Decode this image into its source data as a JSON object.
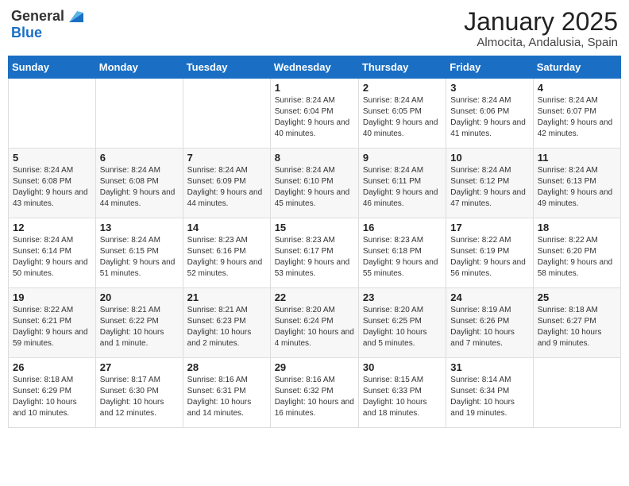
{
  "header": {
    "logo_general": "General",
    "logo_blue": "Blue",
    "title": "January 2025",
    "subtitle": "Almocita, Andalusia, Spain"
  },
  "weekdays": [
    "Sunday",
    "Monday",
    "Tuesday",
    "Wednesday",
    "Thursday",
    "Friday",
    "Saturday"
  ],
  "weeks": [
    [
      {
        "day": "",
        "info": ""
      },
      {
        "day": "",
        "info": ""
      },
      {
        "day": "",
        "info": ""
      },
      {
        "day": "1",
        "info": "Sunrise: 8:24 AM\nSunset: 6:04 PM\nDaylight: 9 hours and 40 minutes."
      },
      {
        "day": "2",
        "info": "Sunrise: 8:24 AM\nSunset: 6:05 PM\nDaylight: 9 hours and 40 minutes."
      },
      {
        "day": "3",
        "info": "Sunrise: 8:24 AM\nSunset: 6:06 PM\nDaylight: 9 hours and 41 minutes."
      },
      {
        "day": "4",
        "info": "Sunrise: 8:24 AM\nSunset: 6:07 PM\nDaylight: 9 hours and 42 minutes."
      }
    ],
    [
      {
        "day": "5",
        "info": "Sunrise: 8:24 AM\nSunset: 6:08 PM\nDaylight: 9 hours and 43 minutes."
      },
      {
        "day": "6",
        "info": "Sunrise: 8:24 AM\nSunset: 6:08 PM\nDaylight: 9 hours and 44 minutes."
      },
      {
        "day": "7",
        "info": "Sunrise: 8:24 AM\nSunset: 6:09 PM\nDaylight: 9 hours and 44 minutes."
      },
      {
        "day": "8",
        "info": "Sunrise: 8:24 AM\nSunset: 6:10 PM\nDaylight: 9 hours and 45 minutes."
      },
      {
        "day": "9",
        "info": "Sunrise: 8:24 AM\nSunset: 6:11 PM\nDaylight: 9 hours and 46 minutes."
      },
      {
        "day": "10",
        "info": "Sunrise: 8:24 AM\nSunset: 6:12 PM\nDaylight: 9 hours and 47 minutes."
      },
      {
        "day": "11",
        "info": "Sunrise: 8:24 AM\nSunset: 6:13 PM\nDaylight: 9 hours and 49 minutes."
      }
    ],
    [
      {
        "day": "12",
        "info": "Sunrise: 8:24 AM\nSunset: 6:14 PM\nDaylight: 9 hours and 50 minutes."
      },
      {
        "day": "13",
        "info": "Sunrise: 8:24 AM\nSunset: 6:15 PM\nDaylight: 9 hours and 51 minutes."
      },
      {
        "day": "14",
        "info": "Sunrise: 8:23 AM\nSunset: 6:16 PM\nDaylight: 9 hours and 52 minutes."
      },
      {
        "day": "15",
        "info": "Sunrise: 8:23 AM\nSunset: 6:17 PM\nDaylight: 9 hours and 53 minutes."
      },
      {
        "day": "16",
        "info": "Sunrise: 8:23 AM\nSunset: 6:18 PM\nDaylight: 9 hours and 55 minutes."
      },
      {
        "day": "17",
        "info": "Sunrise: 8:22 AM\nSunset: 6:19 PM\nDaylight: 9 hours and 56 minutes."
      },
      {
        "day": "18",
        "info": "Sunrise: 8:22 AM\nSunset: 6:20 PM\nDaylight: 9 hours and 58 minutes."
      }
    ],
    [
      {
        "day": "19",
        "info": "Sunrise: 8:22 AM\nSunset: 6:21 PM\nDaylight: 9 hours and 59 minutes."
      },
      {
        "day": "20",
        "info": "Sunrise: 8:21 AM\nSunset: 6:22 PM\nDaylight: 10 hours and 1 minute."
      },
      {
        "day": "21",
        "info": "Sunrise: 8:21 AM\nSunset: 6:23 PM\nDaylight: 10 hours and 2 minutes."
      },
      {
        "day": "22",
        "info": "Sunrise: 8:20 AM\nSunset: 6:24 PM\nDaylight: 10 hours and 4 minutes."
      },
      {
        "day": "23",
        "info": "Sunrise: 8:20 AM\nSunset: 6:25 PM\nDaylight: 10 hours and 5 minutes."
      },
      {
        "day": "24",
        "info": "Sunrise: 8:19 AM\nSunset: 6:26 PM\nDaylight: 10 hours and 7 minutes."
      },
      {
        "day": "25",
        "info": "Sunrise: 8:18 AM\nSunset: 6:27 PM\nDaylight: 10 hours and 9 minutes."
      }
    ],
    [
      {
        "day": "26",
        "info": "Sunrise: 8:18 AM\nSunset: 6:29 PM\nDaylight: 10 hours and 10 minutes."
      },
      {
        "day": "27",
        "info": "Sunrise: 8:17 AM\nSunset: 6:30 PM\nDaylight: 10 hours and 12 minutes."
      },
      {
        "day": "28",
        "info": "Sunrise: 8:16 AM\nSunset: 6:31 PM\nDaylight: 10 hours and 14 minutes."
      },
      {
        "day": "29",
        "info": "Sunrise: 8:16 AM\nSunset: 6:32 PM\nDaylight: 10 hours and 16 minutes."
      },
      {
        "day": "30",
        "info": "Sunrise: 8:15 AM\nSunset: 6:33 PM\nDaylight: 10 hours and 18 minutes."
      },
      {
        "day": "31",
        "info": "Sunrise: 8:14 AM\nSunset: 6:34 PM\nDaylight: 10 hours and 19 minutes."
      },
      {
        "day": "",
        "info": ""
      }
    ]
  ]
}
